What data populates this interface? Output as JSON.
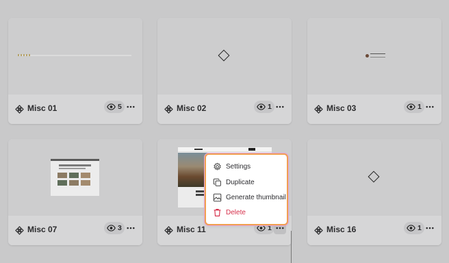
{
  "cards": [
    {
      "title": "Misc 01",
      "views": "5"
    },
    {
      "title": "Misc 02",
      "views": "1"
    },
    {
      "title": "Misc 03",
      "views": "1"
    },
    {
      "title": "Misc 07",
      "views": "3"
    },
    {
      "title": "Misc 11",
      "views": "1"
    },
    {
      "title": "Misc 16",
      "views": "1"
    }
  ],
  "context_menu": {
    "items": [
      {
        "label": "Settings",
        "icon": "gear-icon"
      },
      {
        "label": "Duplicate",
        "icon": "duplicate-icon"
      },
      {
        "label": "Generate thumbnail",
        "icon": "image-icon"
      },
      {
        "label": "Delete",
        "icon": "trash-icon",
        "color": "#d6304b"
      }
    ]
  },
  "colors": {
    "background": "#c9c9ca",
    "card": "#d6d6d7",
    "danger": "#d6304b",
    "menu_outline": "#f0a050"
  }
}
